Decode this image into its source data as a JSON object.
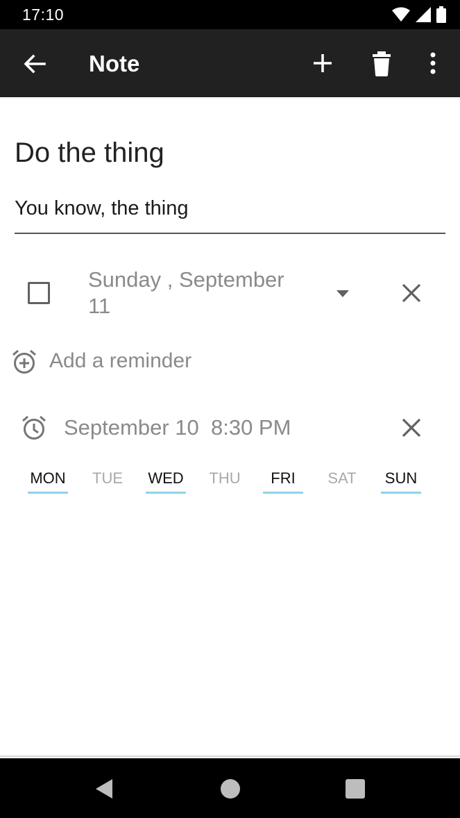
{
  "status_bar": {
    "time": "17:10",
    "icons": [
      "wifi-icon",
      "cell-signal-icon",
      "battery-icon"
    ]
  },
  "toolbar": {
    "title": "Note",
    "icons": [
      "back-arrow-icon",
      "add-icon",
      "delete-icon",
      "more-vert-icon"
    ]
  },
  "note": {
    "title": "Do the thing",
    "body": "You know, the thing"
  },
  "due": {
    "checked": false,
    "date_label": "Sunday , September 11"
  },
  "reminder": {
    "add_label": "Add a reminder",
    "date": "September 10",
    "time": "8:30 PM"
  },
  "days": [
    {
      "label": "MON",
      "selected": true
    },
    {
      "label": "TUE",
      "selected": false
    },
    {
      "label": "WED",
      "selected": true
    },
    {
      "label": "THU",
      "selected": false
    },
    {
      "label": "FRI",
      "selected": true
    },
    {
      "label": "SAT",
      "selected": false
    },
    {
      "label": "SUN",
      "selected": true
    }
  ],
  "colors": {
    "toolbar": "#212121",
    "day_underline": "#8fd2ea",
    "muted_text": "#8a8a8a"
  }
}
